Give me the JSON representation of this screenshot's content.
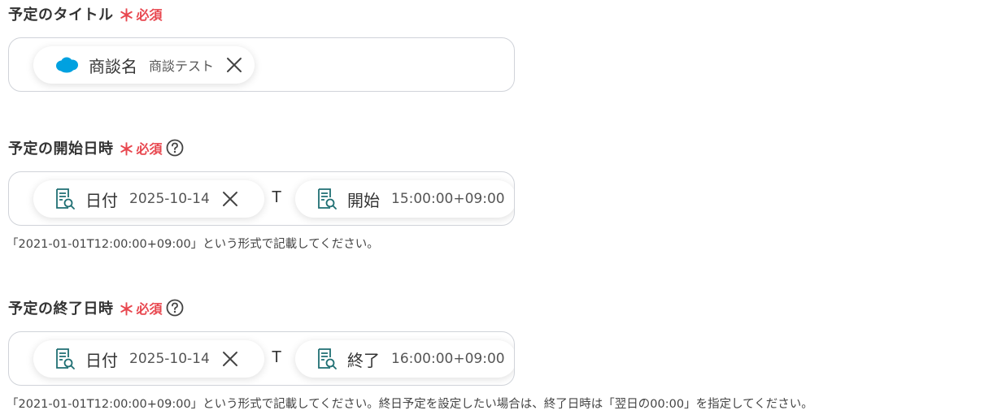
{
  "fields": [
    {
      "label": "予定のタイトル",
      "required_mark": "＊",
      "required_text": "必須",
      "chips": [
        {
          "icon": "salesforce-cloud-icon",
          "label": "商談名",
          "value": "商談テスト"
        }
      ]
    },
    {
      "label": "予定の開始日時",
      "required_mark": "＊",
      "required_text": "必須",
      "help_icon": "question-circle-icon",
      "chips": [
        {
          "icon": "document-search-icon",
          "label": "日付",
          "value": "2025-10-14"
        },
        {
          "icon": "document-search-icon",
          "label": "開始",
          "value": "15:00:00+09:00"
        }
      ],
      "separator": "T",
      "hint": "「2021-01-01T12:00:00+09:00」という形式で記載してください。"
    },
    {
      "label": "予定の終了日時",
      "required_mark": "＊",
      "required_text": "必須",
      "help_icon": "question-circle-icon",
      "chips": [
        {
          "icon": "document-search-icon",
          "label": "日付",
          "value": "2025-10-14"
        },
        {
          "icon": "document-search-icon",
          "label": "終了",
          "value": "16:00:00+09:00"
        }
      ],
      "separator": "T",
      "hint": "「2021-01-01T12:00:00+09:00」という形式で記載してください。終日予定を設定したい場合は、終了日時は「翌日の00:00」を指定してください。"
    }
  ],
  "colors": {
    "required": "#e8474f",
    "salesforce": "#00a1e0",
    "doc_icon": "#1f6f73",
    "border": "#d0d3d9"
  }
}
